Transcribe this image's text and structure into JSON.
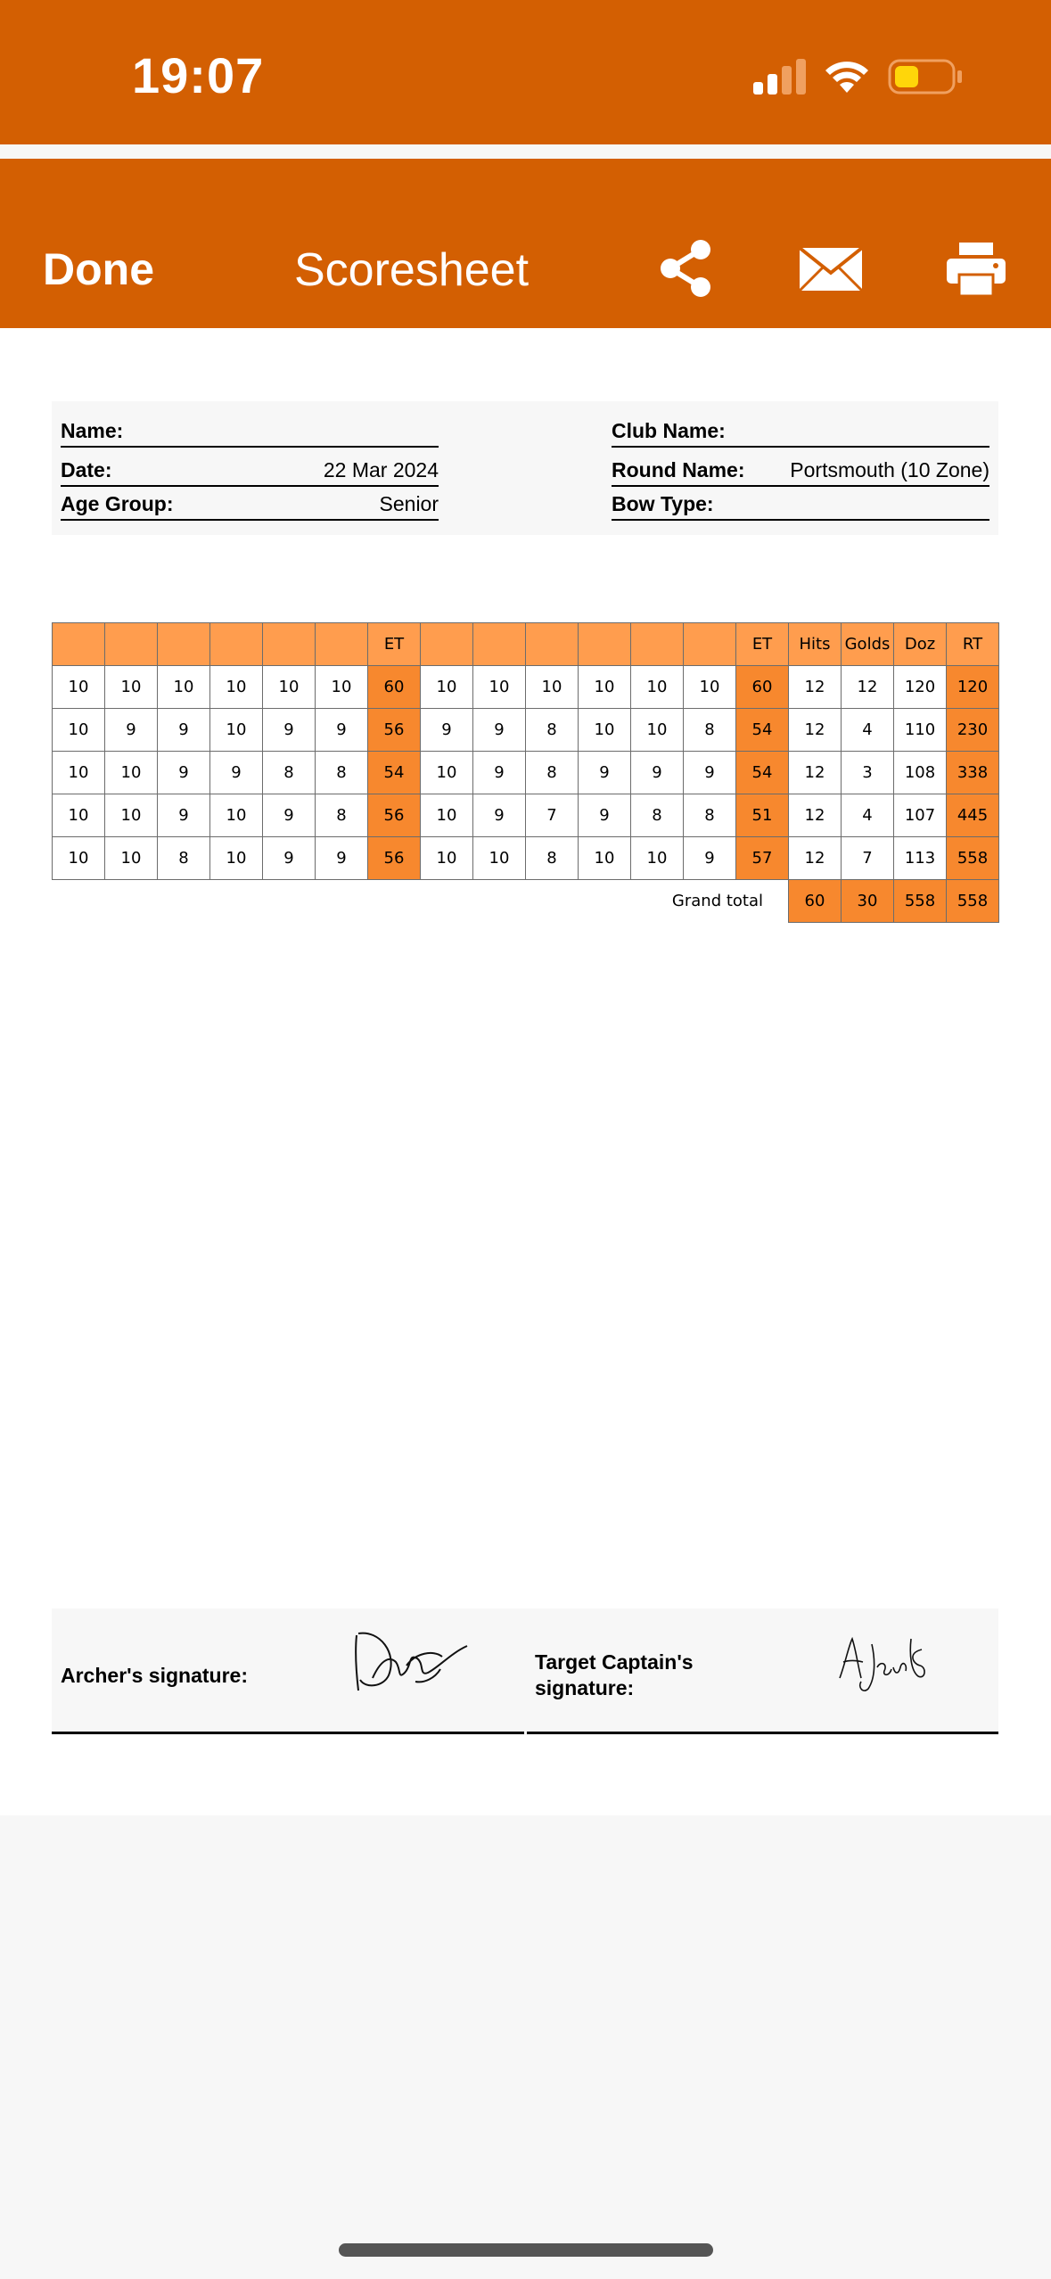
{
  "status_bar": {
    "time": "19:07"
  },
  "nav": {
    "done_label": "Done",
    "title": "Scoresheet",
    "share_icon": "share-icon",
    "mail_icon": "mail-icon",
    "print_icon": "printer-icon"
  },
  "info": {
    "name_label": "Name:",
    "name_value": "",
    "date_label": "Date:",
    "date_value": "22 Mar 2024",
    "age_label": "Age Group:",
    "age_value": "Senior",
    "club_label": "Club Name:",
    "club_value": "",
    "round_label": "Round Name:",
    "round_value": "Portsmouth (10 Zone)",
    "bow_label": "Bow Type:",
    "bow_value": ""
  },
  "table": {
    "headers": [
      "",
      "",
      "",
      "",
      "",
      "",
      "ET",
      "",
      "",
      "",
      "",
      "",
      "",
      "ET",
      "Hits",
      "Golds",
      "Doz",
      "RT"
    ],
    "rows": [
      [
        "10",
        "10",
        "10",
        "10",
        "10",
        "10",
        "60",
        "10",
        "10",
        "10",
        "10",
        "10",
        "10",
        "60",
        "12",
        "12",
        "120",
        "120"
      ],
      [
        "10",
        "9",
        "9",
        "10",
        "9",
        "9",
        "56",
        "9",
        "9",
        "8",
        "10",
        "10",
        "8",
        "54",
        "12",
        "4",
        "110",
        "230"
      ],
      [
        "10",
        "10",
        "9",
        "9",
        "8",
        "8",
        "54",
        "10",
        "9",
        "8",
        "9",
        "9",
        "9",
        "54",
        "12",
        "3",
        "108",
        "338"
      ],
      [
        "10",
        "10",
        "9",
        "10",
        "9",
        "8",
        "56",
        "10",
        "9",
        "7",
        "9",
        "8",
        "8",
        "51",
        "12",
        "4",
        "107",
        "445"
      ],
      [
        "10",
        "10",
        "8",
        "10",
        "9",
        "9",
        "56",
        "10",
        "10",
        "8",
        "10",
        "10",
        "9",
        "57",
        "12",
        "7",
        "113",
        "558"
      ]
    ],
    "grand_total_label": "Grand total",
    "grand_total": [
      "60",
      "30",
      "558",
      "558"
    ]
  },
  "signatures": {
    "archer_label": "Archer's signature:",
    "captain_label": "Target Captain's signature:"
  },
  "colors": {
    "brand_orange": "#d35f02",
    "header_cell": "#ff9d4e",
    "total_cell": "#f7882e"
  }
}
